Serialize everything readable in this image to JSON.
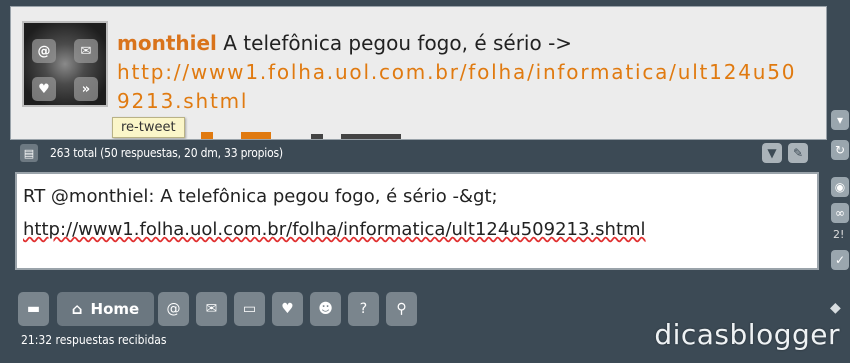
{
  "tweet": {
    "author": "monthiel",
    "text": "A telefônica pegou fogo, é sério ->",
    "link": "http://www1.folha.uol.com.br/folha/informatica/ult124u509213.shtml",
    "tooltip": "re-tweet"
  },
  "status_bar": {
    "count_text": "263 total (50 respuestas, 20 dm, 33 propios)"
  },
  "composer": {
    "line1": "RT @monthiel: A telefônica pegou fogo, é sério -&gt;",
    "line2": "http://www1.folha.uol.com.br/folha/informatica/ult124u509213.shtml"
  },
  "side": {
    "counter": "2!"
  },
  "nav": {
    "home_label": "Home"
  },
  "footer": {
    "status": "21:32 respuestas recibidas",
    "watermark": "dicasblogger"
  },
  "colors": {
    "background": "#3c4a55",
    "accent": "#e07a10",
    "author": "#d9731b"
  },
  "icons": [
    "reply-icon",
    "mention-icon",
    "heart-icon",
    "forward-icon",
    "filter-icon",
    "edit-icon",
    "refresh-icon",
    "camera-icon",
    "link-icon",
    "check-icon",
    "home-icon",
    "mail-icon",
    "folder-icon",
    "users-icon",
    "help-icon",
    "search-icon",
    "tag-icon"
  ]
}
